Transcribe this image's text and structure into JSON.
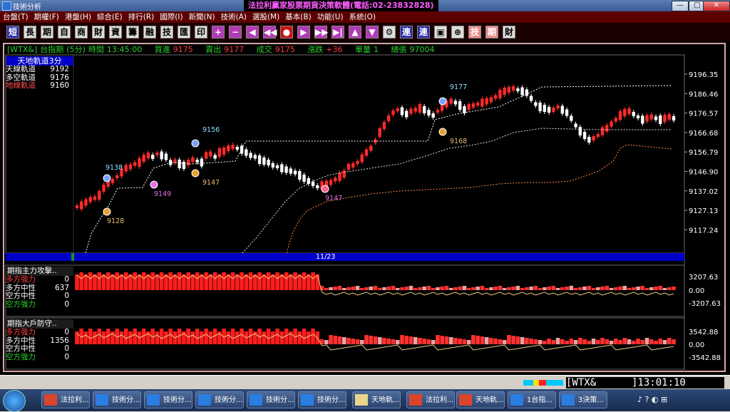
{
  "window": {
    "title": "技術分析",
    "banner": "法拉利贏家股票期貨決策軟體(電話:02-23832828)",
    "min_label": "—",
    "max_label": "□",
    "close_label": "✕"
  },
  "menu": [
    "台盤(T)",
    "期權(F)",
    "港盤(H)",
    "綜合(E)",
    "排行(R)",
    "國際(I)",
    "新聞(N)",
    "技術(A)",
    "選股(M)",
    "基本(B)",
    "功能(U)",
    "系統(O)"
  ],
  "toolbar": [
    "短",
    "長",
    "期",
    "自",
    "商",
    "財",
    "資",
    "籌",
    "融",
    "技",
    "匯",
    "印",
    "+",
    "−",
    "◀",
    "◀◀",
    "●",
    "▶",
    "▶▶",
    "▶|",
    "▲",
    "▼",
    "⚙",
    "連",
    "連",
    "▣",
    "⊕",
    "技",
    "期",
    "財"
  ],
  "info": {
    "symbol": "[WTX&]",
    "name": "台指期",
    "period": "(5分)",
    "time_label": "時間",
    "time": "13:45:00",
    "buy_label": "買進",
    "buy": "9175",
    "sell_label": "賣出",
    "sell": "9177",
    "deal_label": "成交",
    "deal": "9175",
    "chg_label": "漲跌",
    "chg": "+36",
    "vol_label": "單量",
    "vol": "1",
    "total_label": "總張",
    "total": "97004"
  },
  "indicator": {
    "title": "天地軌道3分",
    "rows": [
      {
        "label": "天線軌道",
        "value": "9192",
        "color": "#ffffff"
      },
      {
        "label": "多空軌道",
        "value": "9176",
        "color": "#ffffff"
      },
      {
        "label": "地線軌道",
        "value": "9160",
        "color": "#ff5050"
      }
    ]
  },
  "scroll_label": "11/23",
  "price_axis": [
    "9196.35",
    "9186.46",
    "9176.57",
    "9166.68",
    "9156.79",
    "9146.90",
    "9137.02",
    "9127.13",
    "9117.24"
  ],
  "signals": [
    {
      "label": "9138",
      "kind": "buy"
    },
    {
      "label": "9128",
      "kind": "sell"
    },
    {
      "label": "9149",
      "kind": "mid"
    },
    {
      "label": "9156",
      "kind": "buy"
    },
    {
      "label": "9147",
      "kind": "sell"
    },
    {
      "label": "9147",
      "kind": "mid"
    },
    {
      "label": "9177",
      "kind": "buy"
    },
    {
      "label": "9168",
      "kind": "sell"
    }
  ],
  "panel1": {
    "title": "期指主力攻擊..",
    "rows": [
      {
        "label": "多方強力",
        "value": "0",
        "color": "#ff4040"
      },
      {
        "label": "多方中性",
        "value": "637",
        "color": "#ffffff"
      },
      {
        "label": "空方中性",
        "value": "0",
        "color": "#ffffff"
      },
      {
        "label": "空方強力",
        "value": "0",
        "color": "#2ad22a"
      }
    ],
    "axis": [
      "3207.63",
      "0.00",
      "-3207.63"
    ]
  },
  "panel2": {
    "title": "期指大戶防守..",
    "rows": [
      {
        "label": "多方強力",
        "value": "0",
        "color": "#ff4040"
      },
      {
        "label": "多方中性",
        "value": "1356",
        "color": "#ffffff"
      },
      {
        "label": "空方中性",
        "value": "0",
        "color": "#ffffff"
      },
      {
        "label": "空方強力",
        "value": "0",
        "color": "#2ad22a"
      }
    ],
    "axis": [
      "3542.88",
      "0.00",
      "-3542.88"
    ]
  },
  "status": {
    "symbol": "[WTX&",
    "clock": "]13:01:10"
  },
  "taskbar": [
    "法拉利...",
    "技術分...",
    "技術分...",
    "技術分...",
    "技術分...",
    "技術分...",
    "天地軌...",
    "法拉利...",
    "天地軌...",
    "1台指...",
    "3決策..."
  ],
  "tray": {
    "symbols": "♪ ? ◐ ⊞"
  }
}
